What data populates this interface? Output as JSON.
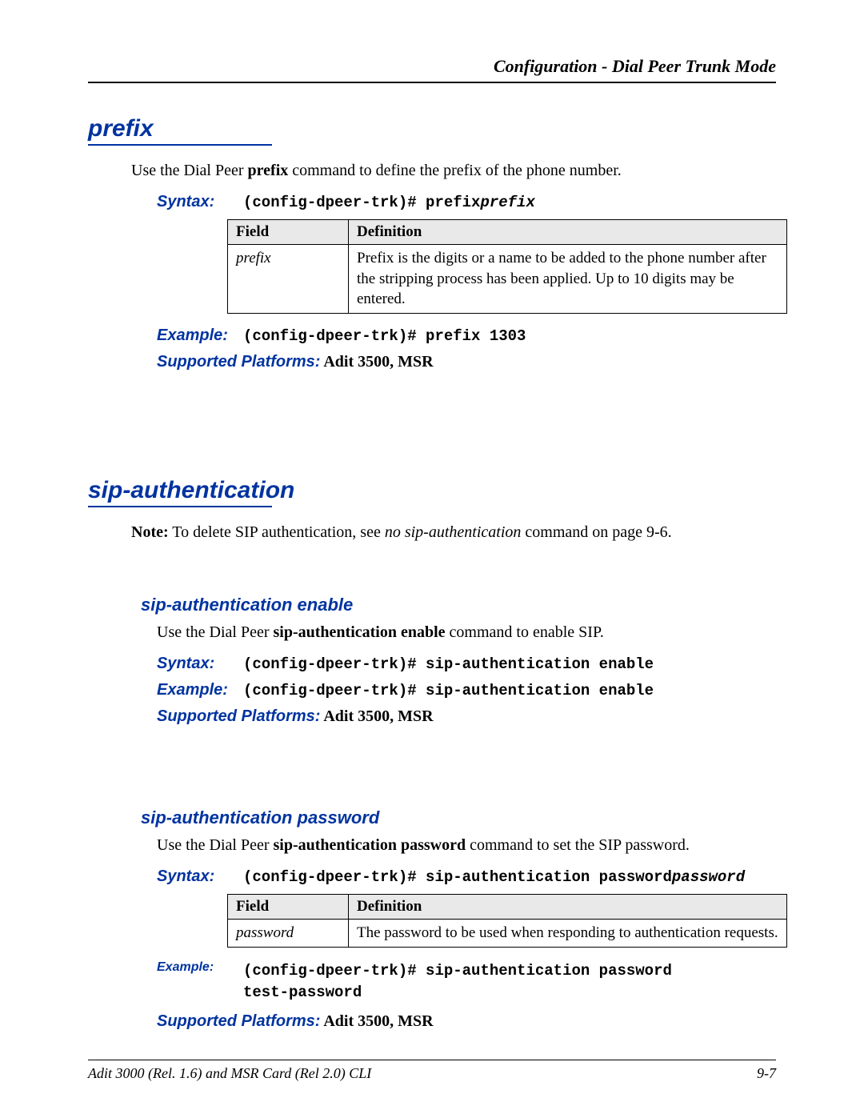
{
  "header": {
    "title": "Configuration - Dial Peer Trunk Mode"
  },
  "sections": {
    "prefix": {
      "heading": "prefix",
      "intro_pre": "Use the Dial Peer ",
      "intro_bold": "prefix",
      "intro_post": " command to define the prefix of the phone number.",
      "syntax_label": "Syntax:",
      "syntax_code": "(config-dpeer-trk)# prefix ",
      "syntax_param": "prefix",
      "table": {
        "col1": "Field",
        "col2": "Definition",
        "row_field": "prefix",
        "row_def": "Prefix is the digits or a name to be added to the phone number after the stripping process has been applied.  Up to 10 digits may be entered."
      },
      "example_label": "Example:",
      "example_code": "(config-dpeer-trk)# prefix 1303",
      "platforms_label": "Supported Platforms:",
      "platforms_value": "  Adit 3500, MSR"
    },
    "sip_auth": {
      "heading": "sip-authentication",
      "note_bold": "Note:",
      "note_pre": " To delete SIP authentication, see ",
      "note_italic": "no sip-authentication",
      "note_post": " command on page 9-6."
    },
    "sip_auth_enable": {
      "subheading": "sip-authentication enable",
      "intro_pre": "Use the Dial Peer ",
      "intro_bold": "sip-authentication enable",
      "intro_post": " command to enable SIP.",
      "syntax_label": "Syntax:",
      "syntax_code": "(config-dpeer-trk)# sip-authentication enable",
      "example_label": "Example:",
      "example_code": "(config-dpeer-trk)# sip-authentication enable",
      "platforms_label": "Supported Platforms:",
      "platforms_value": "  Adit 3500, MSR"
    },
    "sip_auth_password": {
      "subheading": "sip-authentication password",
      "intro_pre": "Use the Dial Peer ",
      "intro_bold": "sip-authentication password",
      "intro_post": " command to set the SIP password.",
      "syntax_label": "Syntax:",
      "syntax_code": "(config-dpeer-trk)# sip-authentication password ",
      "syntax_param": "password",
      "table": {
        "col1": "Field",
        "col2": "Definition",
        "row_field": "password",
        "row_def": "The password to be used when responding to authentication requests."
      },
      "example_label": "Example:",
      "example_code": "(config-dpeer-trk)# sip-authentication password\ntest-password",
      "platforms_label": "Supported Platforms:",
      "platforms_value": "  Adit 3500, MSR"
    }
  },
  "footer": {
    "left": "Adit 3000 (Rel. 1.6) and MSR Card (Rel 2.0) CLI",
    "right": "9-7"
  }
}
